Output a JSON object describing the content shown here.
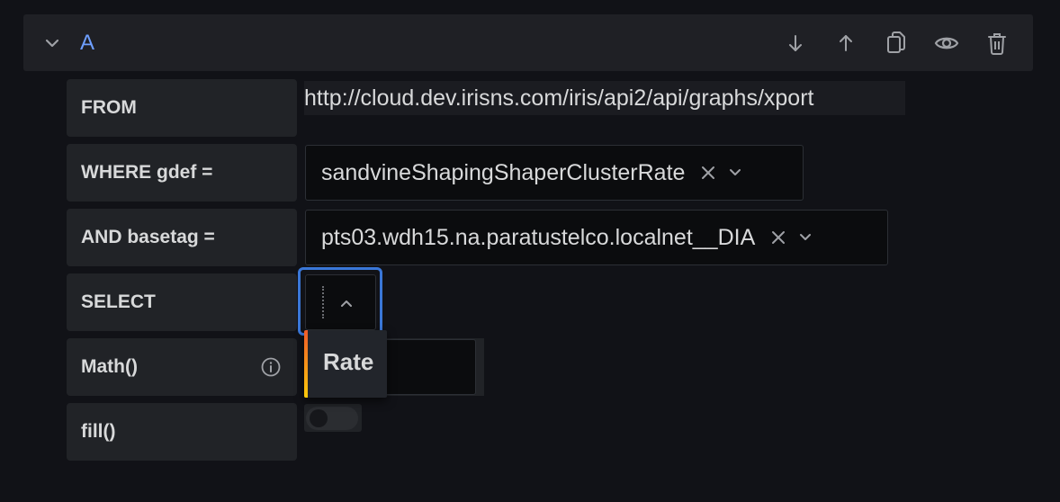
{
  "query": {
    "letter": "A",
    "actions": [
      "move-down",
      "move-up",
      "duplicate",
      "toggle-visibility",
      "delete"
    ]
  },
  "rows": {
    "from": {
      "label": "FROM",
      "value": "http://cloud.dev.irisns.com/iris/api2/api/graphs/xport"
    },
    "where": {
      "label": "WHERE gdef =",
      "value": "sandvineShapingShaperClusterRate"
    },
    "basetag": {
      "label": "AND basetag =",
      "value": "pts03.wdh15.na.paratustelco.localnet__DIA"
    },
    "select": {
      "label": "SELECT",
      "value": ""
    },
    "math": {
      "label": "Math()",
      "value": ""
    },
    "fill": {
      "label": "fill()",
      "enabled": false
    }
  },
  "dropdown": {
    "options": [
      "Rate"
    ]
  },
  "colors": {
    "accent": "#6e9fff",
    "focus": "#3a77d8",
    "background": "#111217",
    "panel": "#212327"
  }
}
